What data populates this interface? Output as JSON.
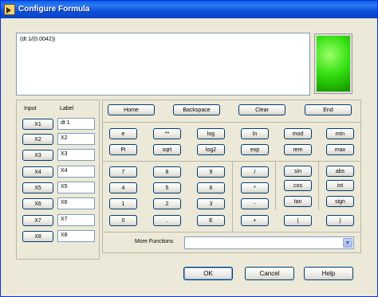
{
  "window": {
    "title": "Configure Formula"
  },
  "expression": {
    "value": "(dt 1/(0.0042))"
  },
  "inputs": {
    "col_input": "Input",
    "col_label": "Label",
    "rows": [
      {
        "input": "X1",
        "label": "dt 1"
      },
      {
        "input": "X2",
        "label": "X2"
      },
      {
        "input": "X3",
        "label": "X3"
      },
      {
        "input": "X4",
        "label": "X4"
      },
      {
        "input": "X5",
        "label": "X5"
      },
      {
        "input": "X6",
        "label": "X6"
      },
      {
        "input": "X7",
        "label": "X7"
      },
      {
        "input": "X8",
        "label": "X8"
      }
    ]
  },
  "editing": {
    "home": "Home",
    "backspace": "Backspace",
    "clear": "Clear",
    "end": "End"
  },
  "functions": {
    "e": "e",
    "pow": "**",
    "log": "log",
    "ln": "ln",
    "mod": "mod",
    "min": "min",
    "pi": "Pi",
    "sqrt": "sqrt",
    "log2": "log2",
    "exp": "exp",
    "rem": "rem",
    "max": "max"
  },
  "keypad": {
    "d7": "7",
    "d8": "8",
    "d9": "9",
    "div": "/",
    "d4": "4",
    "d5": "5",
    "d6": "6",
    "mul": "*",
    "d1": "1",
    "d2": "2",
    "d3": "3",
    "sub": "-",
    "d0": "0",
    "dot": ".",
    "exp_e": "E",
    "add": "+",
    "lparen": "(",
    "rparen": ")"
  },
  "trig": {
    "sin": "sin",
    "cos": "cos",
    "tan": "tan"
  },
  "misc": {
    "abs": "abs",
    "int": "int",
    "sign": "sign"
  },
  "more_functions": {
    "label": "More Functions",
    "value": ""
  },
  "footer": {
    "ok": "OK",
    "cancel": "Cancel",
    "help": "Help"
  }
}
